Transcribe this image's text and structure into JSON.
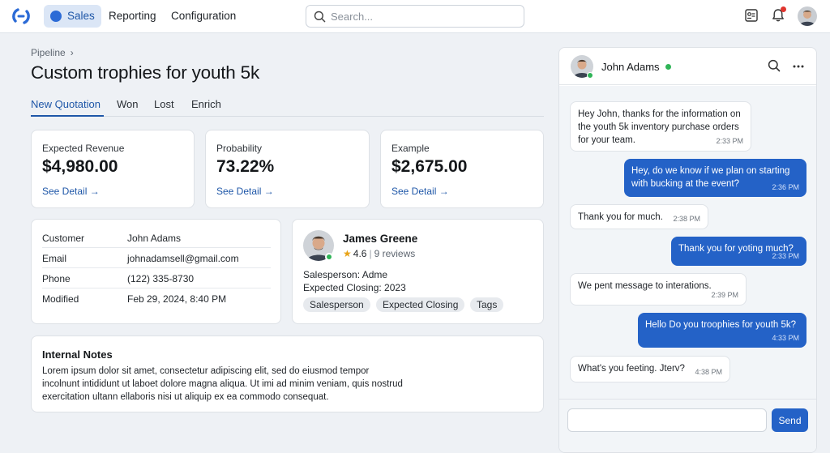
{
  "topbar": {
    "nav": [
      {
        "label": "Sales"
      },
      {
        "label": "Reporting"
      },
      {
        "label": "Configuration"
      }
    ],
    "search_placeholder": "Search..."
  },
  "breadcrumb": "Pipeline",
  "page_title": "Custom trophies for youth 5k",
  "tabs": [
    "New Quotation",
    "Won",
    "Lost",
    "Enrich"
  ],
  "stats": [
    {
      "label": "Expected Revenue",
      "value": "$4,980.00",
      "link": "See Detail →"
    },
    {
      "label": "Probability",
      "value": "73.22%",
      "link": "See Detail →"
    },
    {
      "label": "Example",
      "value": "$2,675.00",
      "link": "See Detail →"
    }
  ],
  "info": [
    {
      "key": "Customer",
      "value": "John Adams"
    },
    {
      "key": "Email",
      "value": "johnadamsell@gmail.com"
    },
    {
      "key": "Phone",
      "value": "(122) 335-8730"
    },
    {
      "key": "Modified",
      "value": "Feb 29, 2024, 8:40 PM"
    }
  ],
  "salesperson": {
    "name": "James Greene",
    "rating": "4.6",
    "reviews": "9 reviews",
    "line1": "Salesperson: Adme",
    "line2": "Expected Closing: 2023",
    "chips": [
      "Salesperson",
      "Expected Closing",
      "Tags"
    ]
  },
  "notes": {
    "title": "Internal Notes",
    "body": "Lorem ipsum dolor sit amet, consectetur adipiscing elit, sed do eiusmod tempor incolnunt intididunt ut laboet dolore magna aliqua. Ut imi ad minim veniam, quis nostrud exercitation ultann ellaboris nisi ut aliquip ex ea commodo consequat."
  },
  "chat": {
    "name": "John Adams",
    "messages": [
      {
        "dir": "in",
        "text": "Hey John, thanks for the information on the youth 5k inventory purchase orders for your team.",
        "time": "2:33 PM"
      },
      {
        "dir": "out",
        "text": "Hey, do we know if we plan on starting with bucking at the event?",
        "time": "2:36 PM"
      },
      {
        "dir": "in",
        "text": "Thank you for much.",
        "time": "2:38 PM"
      },
      {
        "dir": "out",
        "text": "Thank you for yoting much?",
        "time": "2:33 PM"
      },
      {
        "dir": "in",
        "text": "We pent message to interations.",
        "time": "2:39 PM"
      },
      {
        "dir": "out",
        "text": "Hello Do you troophies for youth 5k?",
        "time": "4:33 PM"
      },
      {
        "dir": "in",
        "text": "What's you feeting. Jterv?",
        "time": "4:38 PM"
      }
    ],
    "input_value": "",
    "send_label": "Send"
  },
  "colors": {
    "accent": "#2462c7",
    "link": "#1f57a8",
    "online": "#2fb457",
    "notification": "#e0342e",
    "background": "#eef1f5"
  },
  "icons": [
    "logo-icon",
    "sales-icon",
    "search-icon",
    "contacts-icon",
    "bell-icon",
    "chevron-right-icon",
    "arrow-right-icon",
    "star-icon",
    "more-icon"
  ]
}
